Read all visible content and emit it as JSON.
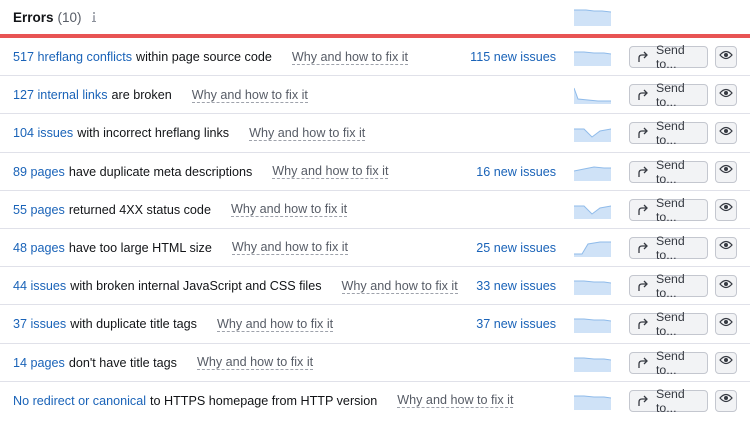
{
  "header": {
    "title": "Errors",
    "count": "(10)",
    "info_icon": "info-icon",
    "accent_color": "#e85454"
  },
  "why_label": "Why and how to fix it",
  "send_label": "Send to...",
  "icons": {
    "send": "share-arrow-icon",
    "view": "eye-icon"
  },
  "colors": {
    "link": "#1a63b8",
    "sparkline_fill": "#cfe2f7",
    "sparkline_stroke": "#8fbbea"
  },
  "rows": [
    {
      "link": "517 hreflang conflicts",
      "text": "within page source code",
      "new_issues": "115 new issues",
      "trend": "flat"
    },
    {
      "link": "127 internal links",
      "text": "are broken",
      "new_issues": "",
      "trend": "drop"
    },
    {
      "link": "104 issues",
      "text": "with incorrect hreflang links",
      "new_issues": "",
      "trend": "dip"
    },
    {
      "link": "89 pages",
      "text": "have duplicate meta descriptions",
      "new_issues": "16 new issues",
      "trend": "bump"
    },
    {
      "link": "55 pages",
      "text": "returned 4XX status code",
      "new_issues": "",
      "trend": "dip"
    },
    {
      "link": "48 pages",
      "text": "have too large HTML size",
      "new_issues": "25 new issues",
      "trend": "rise"
    },
    {
      "link": "44 issues",
      "text": "with broken internal JavaScript and CSS files",
      "new_issues": "33 new issues",
      "trend": "flat"
    },
    {
      "link": "37 issues",
      "text": "with duplicate title tags",
      "new_issues": "37 new issues",
      "trend": "flat"
    },
    {
      "link": "14 pages",
      "text": "don't have title tags",
      "new_issues": "",
      "trend": "flat"
    },
    {
      "link": "No redirect or canonical",
      "text": "to HTTPS homepage from HTTP version",
      "new_issues": "",
      "trend": "flat"
    }
  ]
}
